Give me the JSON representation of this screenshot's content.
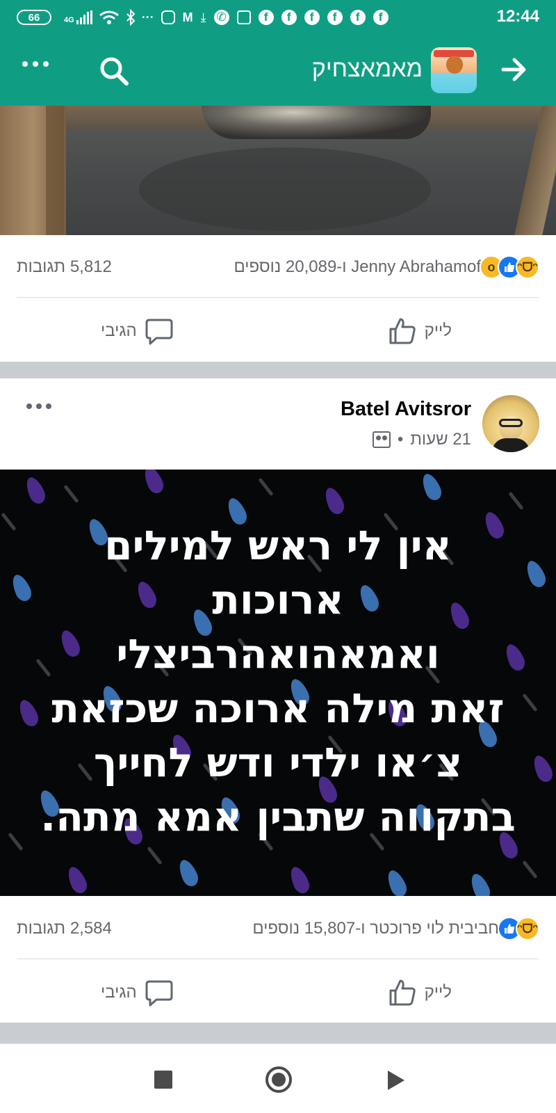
{
  "status_bar": {
    "battery": "66",
    "network": "4G",
    "clock": "12:44",
    "icons": [
      "battery-icon",
      "signal-icon",
      "wifi-icon",
      "bluetooth-icon",
      "more-dots-icon",
      "instagram-icon",
      "gmail-icon",
      "download-icon",
      "whatsapp-icon",
      "calendar-icon",
      "facebook-icon"
    ]
  },
  "app_bar": {
    "title": "מאמאצחיק",
    "color": "#0f9e84"
  },
  "post1": {
    "reactions_text": "Jenny Abrahamof ו-20,089 נוספים",
    "reaction_types": [
      "haha",
      "like",
      "wow"
    ],
    "comments_count": "5,812 תגובות",
    "like_label": "לייק",
    "comment_label": "הגיבי"
  },
  "post2": {
    "author": "Batel Avitsror",
    "time": "21 שעות",
    "meta_separator": "•",
    "image_text_lines": [
      "אין לי ראש למילים",
      "ארוכות",
      "ואמאהואהרביצלי",
      "זאת מילה ארוכה שכזאת",
      "צ׳או ילדי ודש לחייך",
      "בתקווה שתבין אמא מתה."
    ],
    "reactions_text": "חביבית לוי פרוכטר ו-15,807 נוספים",
    "reaction_types": [
      "haha",
      "like"
    ],
    "comments_count": "2,584 תגובות",
    "like_label": "לייק",
    "comment_label": "הגיבי"
  },
  "colors": {
    "like_blue": "#1877f2",
    "text_secondary": "#65676b",
    "haha_yellow": "#f7b928"
  }
}
